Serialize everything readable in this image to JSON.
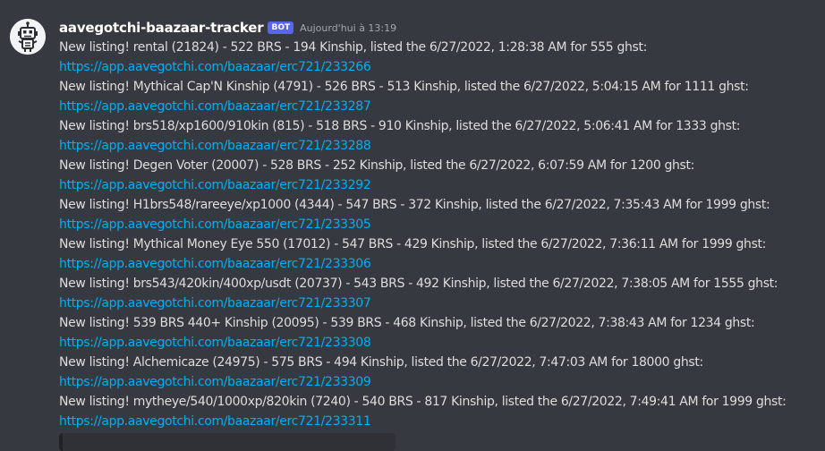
{
  "message": {
    "username": "aavegotchi-baazaar-tracker",
    "badge": "BOT",
    "timestamp": "Aujourd'hui à 13:19",
    "listings": [
      {
        "text": "New listing! rental (21824) - 522 BRS - 194 Kinship,  listed the 6/27/2022, 1:28:38 AM for 555 ghst:",
        "link": "https://app.aavegotchi.com/baazaar/erc721/233266"
      },
      {
        "text": "New listing! Mythical Cap'N Kinship (4791) - 526 BRS - 513 Kinship,  listed the 6/27/2022, 5:04:15 AM for 1111 ghst:",
        "link": "https://app.aavegotchi.com/baazaar/erc721/233287"
      },
      {
        "text": "New listing! brs518/xp1600/910kin (815) - 518 BRS - 910 Kinship,  listed the 6/27/2022, 5:06:41 AM for 1333 ghst:",
        "link": "https://app.aavegotchi.com/baazaar/erc721/233288"
      },
      {
        "text": "New listing! Degen Voter (20007) - 528 BRS - 252 Kinship,  listed the 6/27/2022, 6:07:59 AM for 1200 ghst:",
        "link": "https://app.aavegotchi.com/baazaar/erc721/233292"
      },
      {
        "text": "New listing! H1brs548/rareeye/xp1000 (4344) - 547 BRS - 372 Kinship,  listed the 6/27/2022, 7:35:43 AM for 1999 ghst:",
        "link": "https://app.aavegotchi.com/baazaar/erc721/233305"
      },
      {
        "text": "New listing! Mythical Money Eye 550 (17012) - 547 BRS - 429 Kinship,  listed the 6/27/2022, 7:36:11 AM for 1999 ghst:",
        "link": "https://app.aavegotchi.com/baazaar/erc721/233306"
      },
      {
        "text": "New listing! brs543/420kin/400xp/usdt (20737) - 543 BRS - 492 Kinship,  listed the 6/27/2022, 7:38:05 AM for 1555 ghst:",
        "link": "https://app.aavegotchi.com/baazaar/erc721/233307"
      },
      {
        "text": "New listing! 539 BRS 440+ Kinship (20095) - 539 BRS - 468 Kinship,  listed the 6/27/2022, 7:38:43 AM for 1234 ghst:",
        "link": "https://app.aavegotchi.com/baazaar/erc721/233308"
      },
      {
        "text": "New listing! Alchemicaze (24975) - 575 BRS - 494 Kinship,  listed the 6/27/2022, 7:47:03 AM for 18000 ghst:",
        "link": "https://app.aavegotchi.com/baazaar/erc721/233309"
      },
      {
        "text": "New listing! mytheye/540/1000xp/820kin (7240) - 540 BRS - 817 Kinship,  listed the 6/27/2022, 7:49:41 AM for 1999 ghst:",
        "link": "https://app.aavegotchi.com/baazaar/erc721/233311"
      }
    ]
  },
  "colors": {
    "background": "#36393f",
    "text": "#dcddde",
    "username": "#ffffff",
    "link": "#00b0f4",
    "bot_badge": "#5865f2",
    "timestamp": "#a3a6aa"
  },
  "icons": {
    "avatar": "robot-avatar-icon"
  }
}
